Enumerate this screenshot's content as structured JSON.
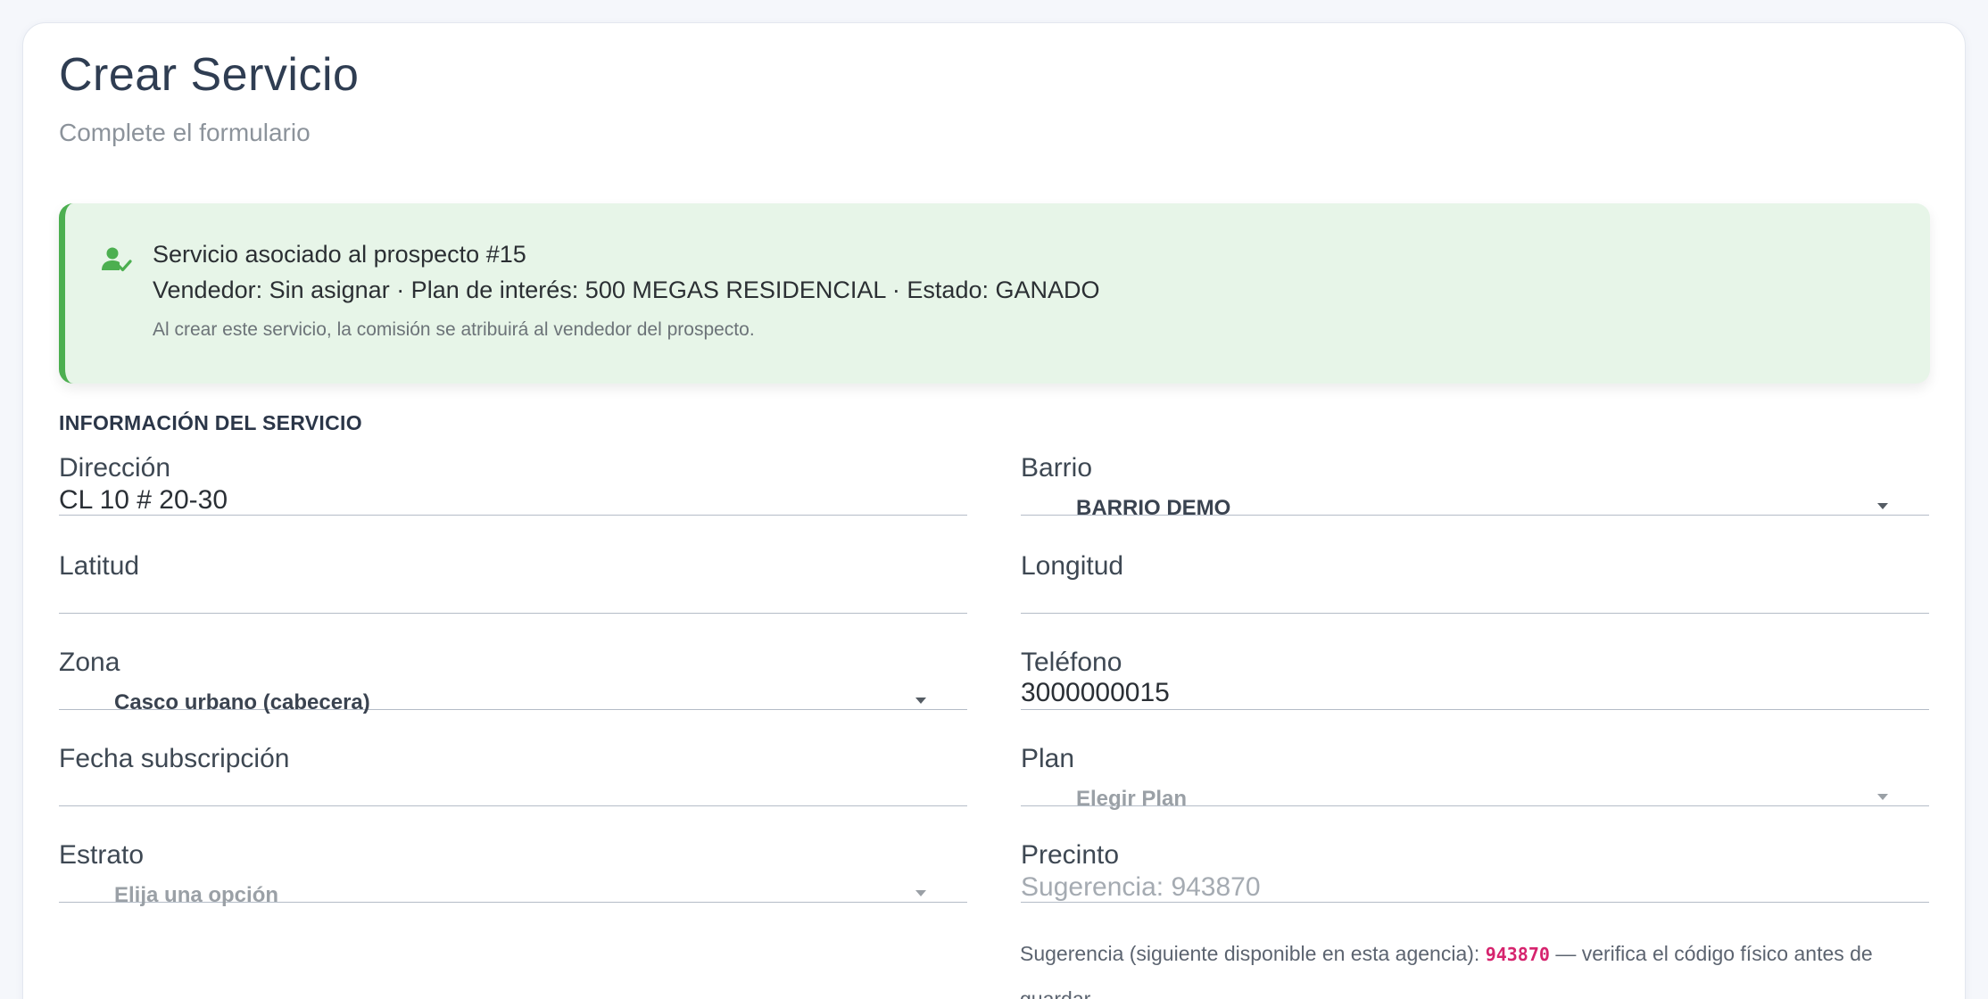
{
  "page": {
    "title": "Crear Servicio",
    "subtitle": "Complete el formulario"
  },
  "alert": {
    "icon": "person-check-icon",
    "line1": "Servicio asociado al prospecto #15",
    "line2": "Vendedor: Sin asignar · Plan de interés: 500 MEGAS RESIDENCIAL · Estado: GANADO",
    "note": "Al crear este servicio, la comisión se atribuirá al vendedor del prospecto.",
    "accent_color": "#4caf50",
    "background_color": "#e7f5e8"
  },
  "section": {
    "title": "INFORMACIÓN DEL SERVICIO"
  },
  "fields": {
    "direccion": {
      "label": "Dirección",
      "value": "CL 10 # 20-30"
    },
    "barrio": {
      "label": "Barrio",
      "value": "BARRIO DEMO"
    },
    "latitud": {
      "label": "Latitud",
      "value": ""
    },
    "longitud": {
      "label": "Longitud",
      "value": ""
    },
    "zona": {
      "label": "Zona",
      "value": "Casco urbano (cabecera)"
    },
    "telefono": {
      "label": "Teléfono",
      "value": "3000000015"
    },
    "fecha": {
      "label": "Fecha subscripción",
      "value": ""
    },
    "plan": {
      "label": "Plan",
      "placeholder": "Elegir Plan"
    },
    "estrato": {
      "label": "Estrato",
      "placeholder": "Elija una opción"
    },
    "precinto": {
      "label": "Precinto",
      "placeholder": "Sugerencia: 943870"
    }
  },
  "hint": {
    "prefix": "Sugerencia (siguiente disponible en esta agencia):",
    "code": "943870",
    "suffix": "— verifica el código físico antes de guardar",
    "code_color": "#d6246e"
  }
}
